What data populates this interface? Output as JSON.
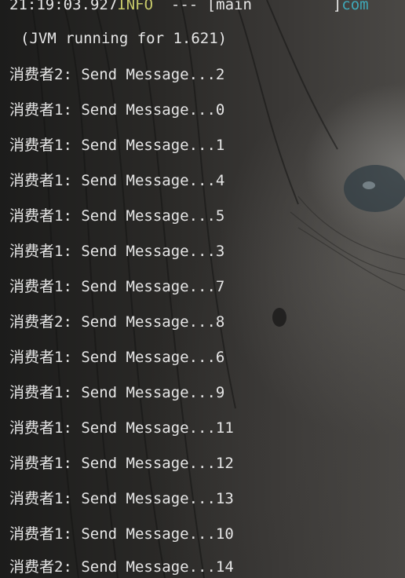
{
  "header": {
    "timestamp": "21:19:03.927",
    "level": "INFO",
    "separator": "  --- [",
    "thread": "main",
    "thread_pad": "         ]",
    "logger": "com"
  },
  "jvm_line": "(JVM running for 1.621)",
  "messages": [
    "消费者2: Send Message...2",
    "消费者1: Send Message...0",
    "消费者1: Send Message...1",
    "消费者1: Send Message...4",
    "消费者1: Send Message...5",
    "消费者1: Send Message...3",
    "消费者1: Send Message...7",
    "消费者2: Send Message...8",
    "消费者1: Send Message...6",
    "消费者1: Send Message...9",
    "消费者1: Send Message...11",
    "消费者1: Send Message...12",
    "消费者1: Send Message...13",
    "消费者1: Send Message...10",
    "消费者2: Send Message...14"
  ],
  "colors": {
    "text": "#e6e6e6",
    "level": "#c7c96a",
    "logger": "#3fa8b8"
  }
}
